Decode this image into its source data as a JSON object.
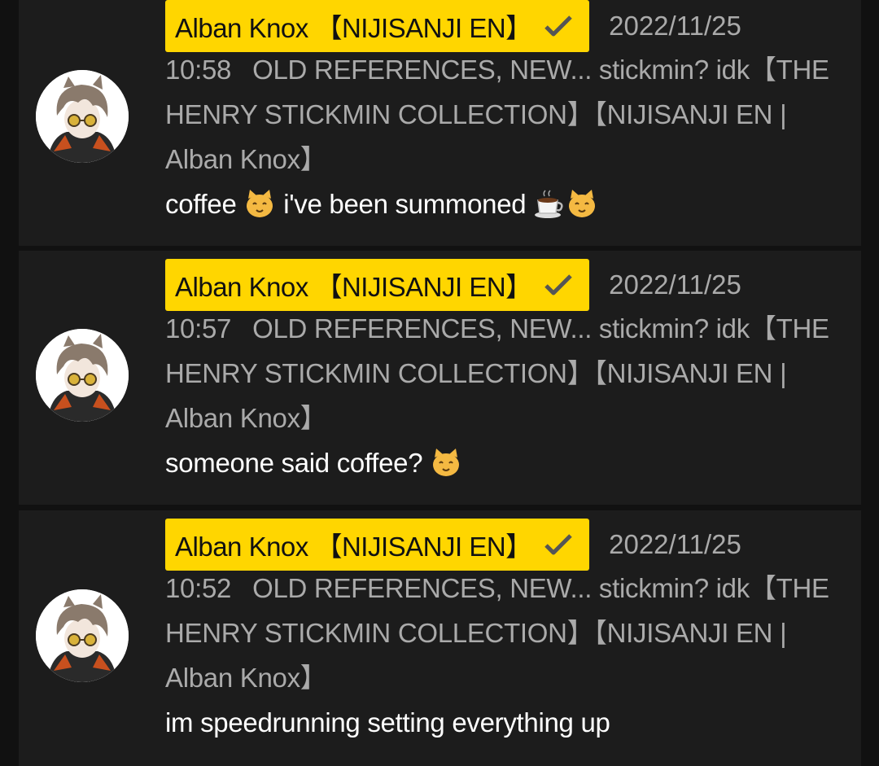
{
  "comments": [
    {
      "author": "Alban Knox 【NIJISANJI EN】",
      "date": "2022/11/25",
      "time": "10:58",
      "video_title": "OLD REFERENCES, NEW... stickmin? idk【THE HENRY STICKMIN COLLECTION】【NIJISANJI EN | Alban Knox】",
      "message": "coffee",
      "message_mid": "i've been summoned",
      "emojis": [
        "cat-face",
        "coffee-cup",
        "cat-face"
      ]
    },
    {
      "author": "Alban Knox 【NIJISANJI EN】",
      "date": "2022/11/25",
      "time": "10:57",
      "video_title": "OLD REFERENCES, NEW... stickmin? idk【THE HENRY STICKMIN COLLECTION】【NIJISANJI EN | Alban Knox】",
      "message": "someone said coffee?",
      "emojis": [
        "cat-face"
      ]
    },
    {
      "author": "Alban Knox 【NIJISANJI EN】",
      "date": "2022/11/25",
      "time": "10:52",
      "video_title": "OLD REFERENCES, NEW... stickmin? idk【THE HENRY STICKMIN COLLECTION】【NIJISANJI EN | Alban Knox】",
      "message": "im speedrunning setting everything up"
    }
  ],
  "colors": {
    "badge_bg": "#ffd600",
    "card_bg": "#1c1c1c",
    "page_bg": "#111111",
    "meta_text": "#aaaaaa",
    "message_text": "#ffffff"
  }
}
